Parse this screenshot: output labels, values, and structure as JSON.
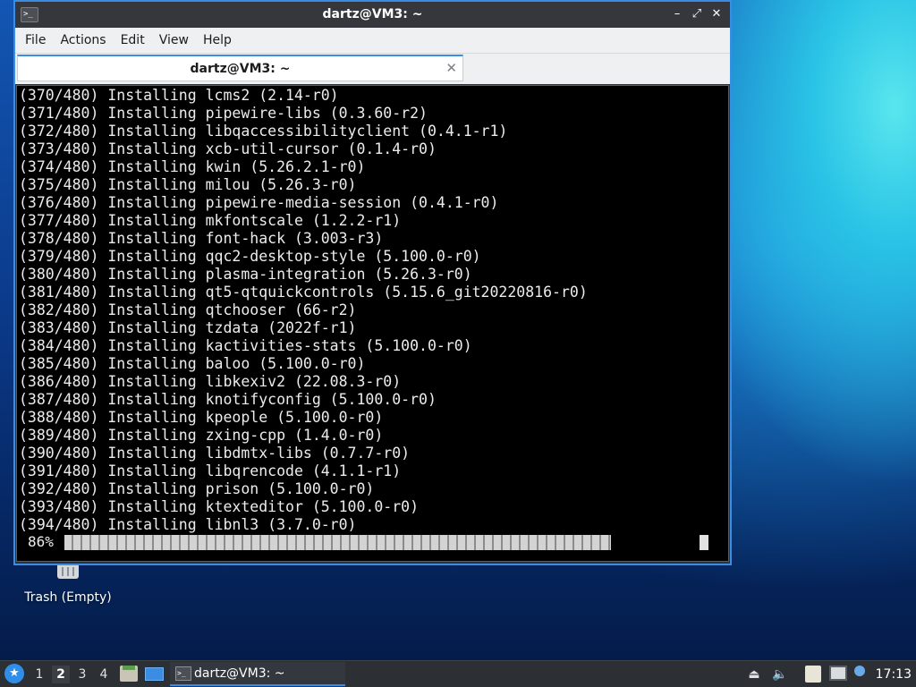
{
  "desktop": {
    "trash_label": "Trash (Empty)"
  },
  "window": {
    "title": "dartz@VM3: ~",
    "menu": [
      "File",
      "Actions",
      "Edit",
      "View",
      "Help"
    ],
    "tab_title": "dartz@VM3: ~"
  },
  "terminal": {
    "lines": [
      "(370/480) Installing lcms2 (2.14-r0)",
      "(371/480) Installing pipewire-libs (0.3.60-r2)",
      "(372/480) Installing libqaccessibilityclient (0.4.1-r1)",
      "(373/480) Installing xcb-util-cursor (0.1.4-r0)",
      "(374/480) Installing kwin (5.26.2.1-r0)",
      "(375/480) Installing milou (5.26.3-r0)",
      "(376/480) Installing pipewire-media-session (0.4.1-r0)",
      "(377/480) Installing mkfontscale (1.2.2-r1)",
      "(378/480) Installing font-hack (3.003-r3)",
      "(379/480) Installing qqc2-desktop-style (5.100.0-r0)",
      "(380/480) Installing plasma-integration (5.26.3-r0)",
      "(381/480) Installing qt5-qtquickcontrols (5.15.6_git20220816-r0)",
      "(382/480) Installing qtchooser (66-r2)",
      "(383/480) Installing tzdata (2022f-r1)",
      "(384/480) Installing kactivities-stats (5.100.0-r0)",
      "(385/480) Installing baloo (5.100.0-r0)",
      "(386/480) Installing libkexiv2 (22.08.3-r0)",
      "(387/480) Installing knotifyconfig (5.100.0-r0)",
      "(388/480) Installing kpeople (5.100.0-r0)",
      "(389/480) Installing zxing-cpp (1.4.0-r0)",
      "(390/480) Installing libdmtx-libs (0.7.7-r0)",
      "(391/480) Installing libqrencode (4.1.1-r1)",
      "(392/480) Installing prison (5.100.0-r0)",
      "(393/480) Installing ktexteditor (5.100.0-r0)",
      "(394/480) Installing libnl3 (3.7.0-r0)"
    ],
    "progress_text": "86%",
    "progress_fraction": 0.86
  },
  "taskbar": {
    "workspaces": [
      "1",
      "2",
      "3",
      "4"
    ],
    "active_workspace": "2",
    "task_label": "dartz@VM3: ~",
    "clock": "17:13"
  },
  "colors": {
    "accent": "#3b8de4",
    "terminal_bg": "#000000",
    "terminal_fg": "#ececec"
  }
}
